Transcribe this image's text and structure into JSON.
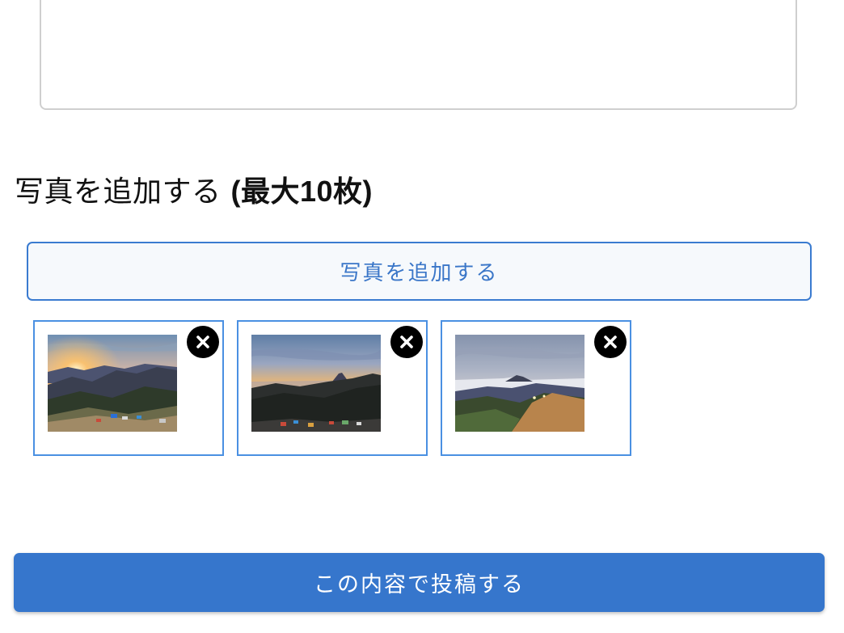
{
  "form": {
    "body_value": "",
    "photos_heading_prefix": "写真を追加する ",
    "photos_heading_suffix": "(最大10枚)",
    "add_photo_label": "写真を追加する",
    "submit_label": "この内容で投稿する"
  },
  "photos": [
    {
      "scene": "sunrise-over-mountains-tents",
      "remove_icon": "close-circle-icon"
    },
    {
      "scene": "sunrise-mount-fuji-tents",
      "remove_icon": "close-circle-icon"
    },
    {
      "scene": "evening-ridge-sea-of-clouds",
      "remove_icon": "close-circle-icon"
    }
  ],
  "colors": {
    "accent": "#3676cc",
    "add_button_border": "#3a7bd0",
    "thumb_border": "#4a90e2"
  }
}
